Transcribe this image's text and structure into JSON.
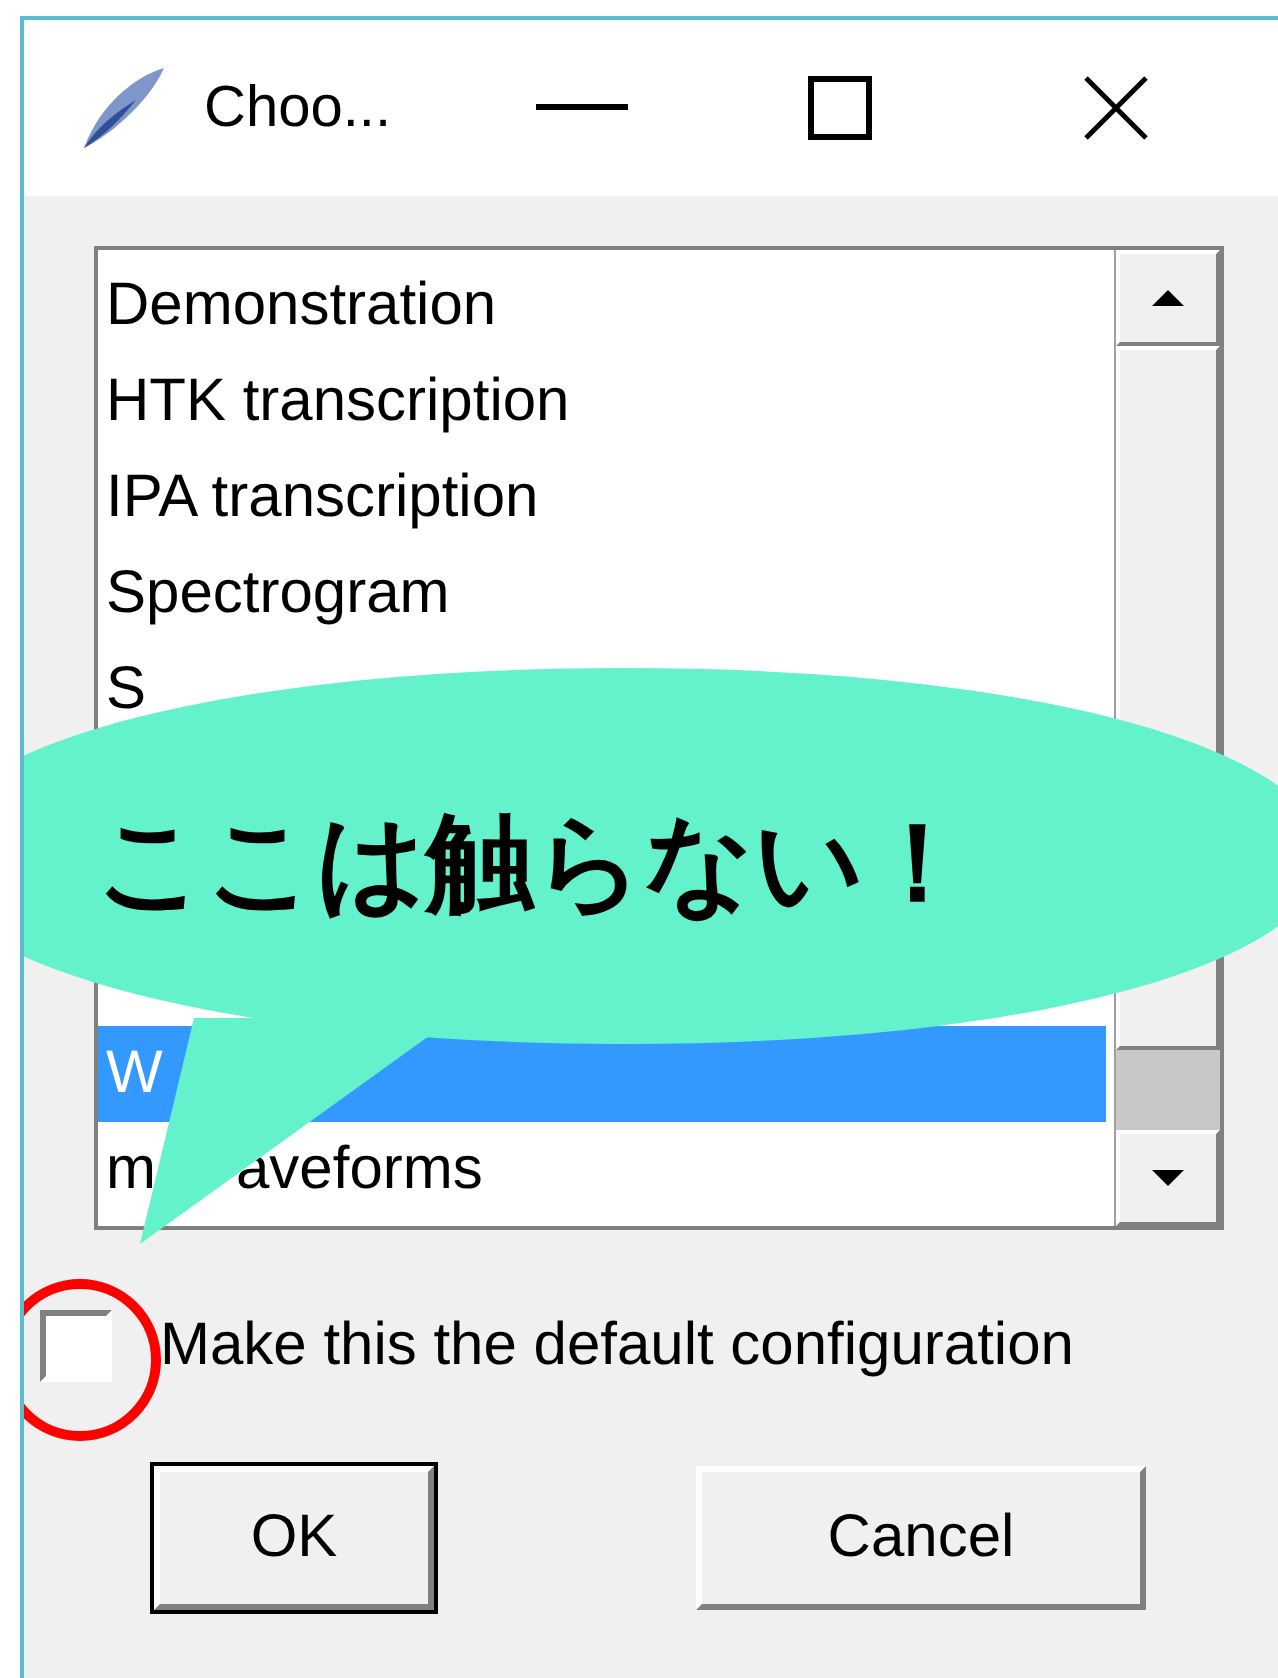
{
  "window": {
    "title": "Choo..."
  },
  "list": {
    "items": [
      {
        "label": "Demonstration",
        "selected": false
      },
      {
        "label": "HTK transcription",
        "selected": false
      },
      {
        "label": "IPA transcription",
        "selected": false
      },
      {
        "label": "Spectrogram",
        "selected": false
      },
      {
        "label": "S",
        "selected": false
      },
      {
        "label": "W",
        "selected": true
      },
      {
        "label": "m",
        "label_end": "aveforms",
        "selected": false
      }
    ]
  },
  "callout": {
    "text": "ここは触らない！"
  },
  "checkbox": {
    "label": "Make this the default configuration",
    "checked": false
  },
  "buttons": [
    {
      "label": "OK",
      "default": true
    },
    {
      "label": "Cancel",
      "default": false
    }
  ]
}
